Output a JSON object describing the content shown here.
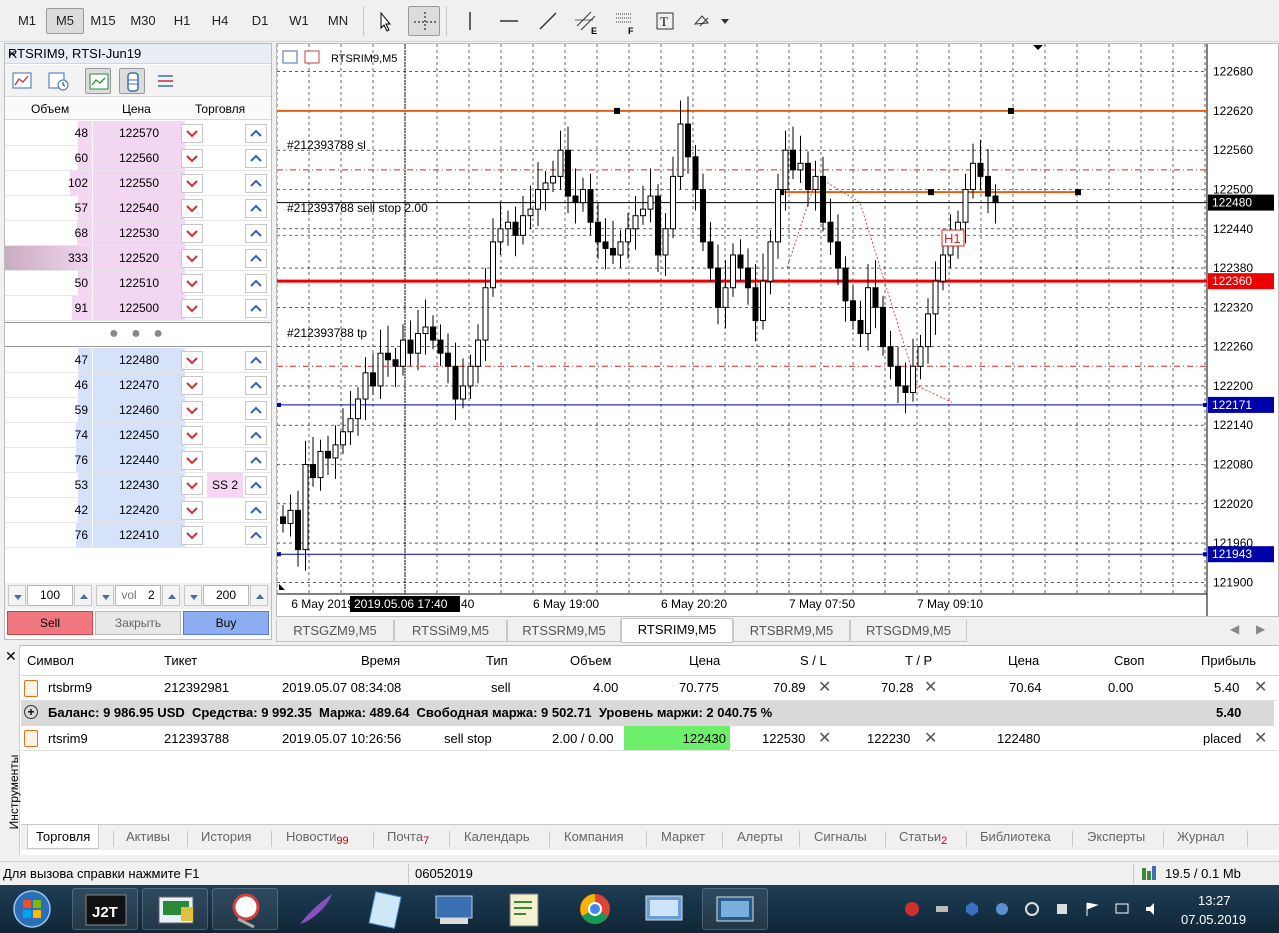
{
  "toolbar": {
    "timeframes": [
      "M1",
      "M5",
      "M15",
      "M30",
      "H1",
      "H4",
      "D1",
      "W1",
      "MN"
    ],
    "active_timeframe": "M5",
    "tools": [
      "cursor-icon",
      "crosshair-icon",
      "vertical-line-icon",
      "horizontal-line-icon",
      "trend-line-icon",
      "equidistant-channel-icon",
      "fibonacci-icon",
      "text-icon",
      "shapes-icon"
    ]
  },
  "dom": {
    "title": "RTSRIM9, RTSI-Jun19",
    "close": "×",
    "headers": {
      "volume": "Объем",
      "price": "Цена",
      "trade": "Торговля"
    },
    "asks": [
      {
        "volume": "48",
        "price": "122570"
      },
      {
        "volume": "60",
        "price": "122560"
      },
      {
        "volume": "102",
        "price": "122550"
      },
      {
        "volume": "57",
        "price": "122540"
      },
      {
        "volume": "68",
        "price": "122530"
      },
      {
        "volume": "333",
        "price": "122520"
      },
      {
        "volume": "50",
        "price": "122510"
      },
      {
        "volume": "91",
        "price": "122500"
      }
    ],
    "dots": "● ● ●",
    "bids": [
      {
        "volume": "47",
        "price": "122480",
        "order": ""
      },
      {
        "volume": "46",
        "price": "122470",
        "order": ""
      },
      {
        "volume": "59",
        "price": "122460",
        "order": ""
      },
      {
        "volume": "74",
        "price": "122450",
        "order": ""
      },
      {
        "volume": "76",
        "price": "122440",
        "order": ""
      },
      {
        "volume": "53",
        "price": "122430",
        "order": "SS 2"
      },
      {
        "volume": "42",
        "price": "122420",
        "order": ""
      },
      {
        "volume": "76",
        "price": "122410",
        "order": ""
      }
    ],
    "qty_left": "100",
    "vol_label": "vol",
    "vol_value": "2",
    "qty_right": "200",
    "sell_label": "Sell",
    "close_label": "Закрыть",
    "buy_label": "Buy"
  },
  "chart": {
    "symbol_label": "RTSRIM9,M5",
    "price_axis": [
      "122680",
      "122620",
      "122560",
      "122500",
      "122440",
      "122380",
      "122320",
      "122260",
      "122200",
      "122140",
      "122080",
      "122020",
      "121960",
      "121900"
    ],
    "current_price": "122480",
    "red_level": "122360",
    "blue_level_1": "122171",
    "blue_level_2": "121943",
    "label_sl": "#212393788 sl",
    "label_sellstop": "#212393788 sell stop 2.00",
    "label_tp": "#212393788 tp",
    "label_h1": "H1",
    "time_axis": [
      "6 May 2019",
      "40",
      "6 May 19:00",
      "6 May 20:20",
      "7 May 07:50",
      "7 May 09:10"
    ],
    "time_cursor": "2019.05.06 17:40",
    "colors": {
      "sl_tp": "#dd2222",
      "entry": "#22aa44",
      "red_level": "#ee0000",
      "blue_level": "#0000aa",
      "orange": "#e06010"
    }
  },
  "chart_data": {
    "type": "candlestick",
    "title": "RTSRIM9,M5",
    "ylim": [
      121870,
      122710
    ],
    "x_ticks": [
      "6 May 2019",
      "6 May 19:00",
      "6 May 20:20",
      "7 May 07:50",
      "7 May 09:10"
    ],
    "close_path": [
      121990,
      122010,
      121950,
      122080,
      122060,
      122100,
      122090,
      122110,
      122130,
      122150,
      122180,
      122220,
      122200,
      122250,
      122240,
      122230,
      122270,
      122250,
      122280,
      122290,
      122270,
      122250,
      122230,
      122180,
      122200,
      122230,
      122270,
      122350,
      122420,
      122440,
      122450,
      122430,
      122460,
      122470,
      122500,
      122510,
      122520,
      122560,
      122490,
      122480,
      122500,
      122450,
      122420,
      122410,
      122400,
      122420,
      122440,
      122460,
      122470,
      122490,
      122400,
      122440,
      122520,
      122600,
      122550,
      122500,
      122420,
      122380,
      122320,
      122350,
      122400,
      122380,
      122350,
      122300,
      122360,
      122420,
      122500,
      122560,
      122530,
      122540,
      122500,
      122520,
      122450,
      122420,
      122380,
      122330,
      122300,
      122280,
      122350,
      122320,
      122260,
      122230,
      122200,
      122190,
      122230,
      122260,
      122310,
      122360,
      122400,
      122420,
      122450,
      122500,
      122540,
      122520,
      122490,
      122480
    ]
  },
  "chart_tabs": [
    "RTSGZM9,M5",
    "RTSSiM9,M5",
    "RTSSRM9,M5",
    "RTSRIM9,M5",
    "RTSBRM9,M5",
    "RTSGDM9,M5"
  ],
  "active_chart_tab": "RTSRIM9,M5",
  "terminal": {
    "side_label": "Инструменты",
    "headers": [
      "Символ",
      "Тикет",
      "Время",
      "Тип",
      "Объем",
      "Цена",
      "S / L",
      "T / P",
      "Цена",
      "Своп",
      "Прибыль"
    ],
    "positions": [
      {
        "symbol": "rtsbrm9",
        "ticket": "212392981",
        "time": "2019.05.07 08:34:08",
        "type": "sell",
        "volume": "4.00",
        "price": "70.775",
        "sl": "70.89",
        "tp": "70.28",
        "current": "70.64",
        "swap": "0.00",
        "profit": "5.40"
      }
    ],
    "balance_line": "Баланс: 9 986.95 USD  Средства: 9 992.35  Маржа: 489.64  Свободная маржа: 9 502.71  Уровень маржи: 2 040.75 %",
    "balance_profit": "5.40",
    "orders": [
      {
        "symbol": "rtsrim9",
        "ticket": "212393788",
        "time": "2019.05.07 10:26:56",
        "type": "sell stop",
        "volume": "2.00 / 0.00",
        "price": "122430",
        "sl": "122530",
        "tp": "122230",
        "current": "122480",
        "status": "placed"
      }
    ],
    "tabs": [
      {
        "label": "Торговля",
        "badge": ""
      },
      {
        "label": "Активы",
        "badge": ""
      },
      {
        "label": "История",
        "badge": ""
      },
      {
        "label": "Новости",
        "badge": "99"
      },
      {
        "label": "Почта",
        "badge": "7"
      },
      {
        "label": "Календарь",
        "badge": ""
      },
      {
        "label": "Компания",
        "badge": ""
      },
      {
        "label": "Маркет",
        "badge": ""
      },
      {
        "label": "Алерты",
        "badge": ""
      },
      {
        "label": "Сигналы",
        "badge": ""
      },
      {
        "label": "Статьи",
        "badge": "2"
      },
      {
        "label": "Библиотека",
        "badge": ""
      },
      {
        "label": "Эксперты",
        "badge": ""
      },
      {
        "label": "Журнал",
        "badge": ""
      }
    ]
  },
  "status": {
    "help": "Для вызова справки нажмите F1",
    "profile": "06052019",
    "traffic": "19.5 / 0.1 Mb"
  },
  "taskbar": {
    "apps": [
      "start-orb",
      "j2t-app",
      "terminal-app",
      "snipping-app",
      "feather-app",
      "notepad-app",
      "keyboard-app",
      "editor-app",
      "chrome-app",
      "network-app",
      "display-app"
    ],
    "clock_time": "13:27",
    "clock_date": "07.05.2019"
  }
}
